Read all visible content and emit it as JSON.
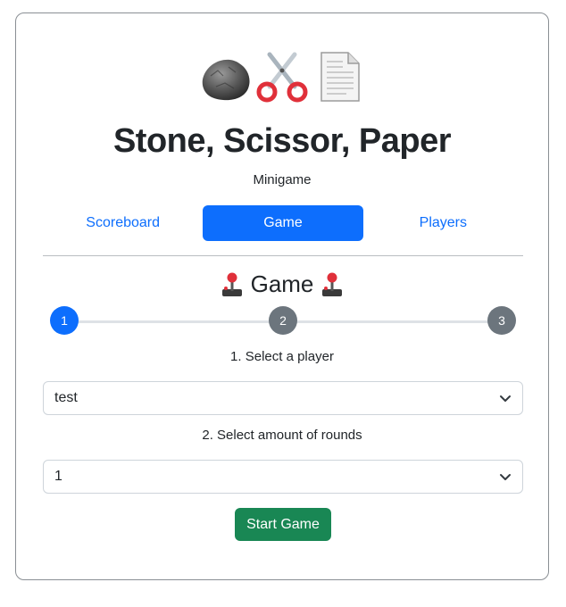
{
  "header": {
    "icons": [
      "rock-icon",
      "scissors-icon",
      "paper-icon"
    ],
    "title": "Stone, Scissor, Paper",
    "subtitle": "Minigame"
  },
  "nav": {
    "tabs": [
      {
        "label": "Scoreboard",
        "active": false
      },
      {
        "label": "Game",
        "active": true
      },
      {
        "label": "Players",
        "active": false
      }
    ]
  },
  "game": {
    "title": "Game",
    "title_icon": "joystick-icon",
    "steps": [
      "1",
      "2",
      "3"
    ],
    "current_step": 1,
    "step1_label": "1. Select a player",
    "player_value": "test",
    "step2_label": "2. Select amount of rounds",
    "rounds_value": "1",
    "start_label": "Start Game"
  },
  "colors": {
    "primary": "#0d6efd",
    "success": "#198754",
    "secondary": "#6c757d"
  }
}
